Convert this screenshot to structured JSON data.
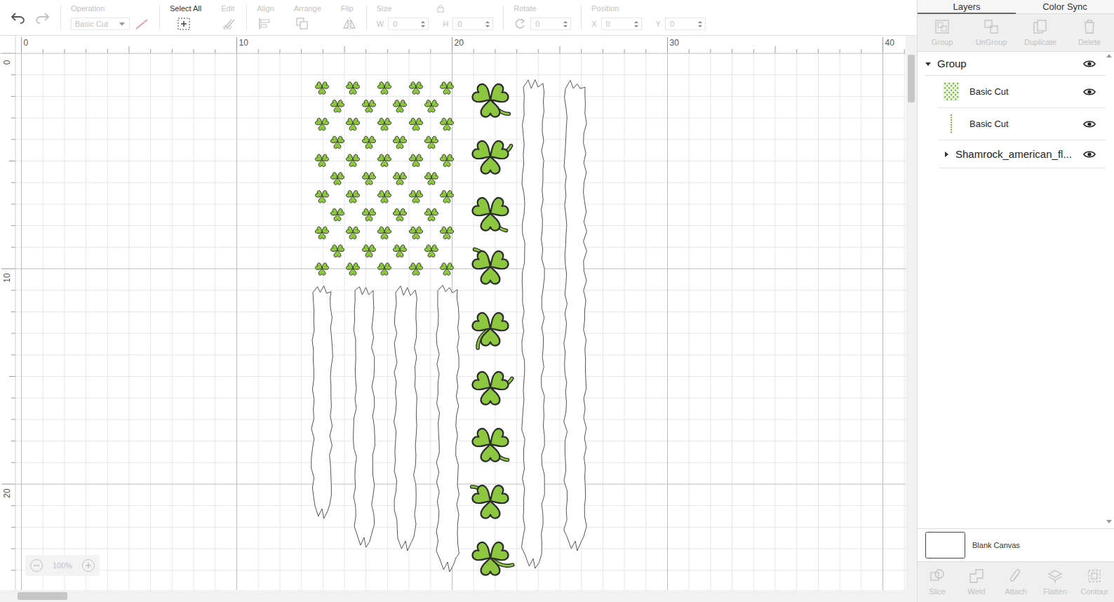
{
  "toolbar": {
    "undo": {
      "disabled": false
    },
    "redo": {
      "disabled": true
    },
    "tools": [
      {
        "kind": "dropdown",
        "label": "Operation",
        "value": "Basic Cut",
        "disabled": true
      },
      {
        "kind": "button",
        "label": "Select All",
        "disabled": false
      },
      {
        "kind": "button",
        "label": "Edit",
        "disabled": true
      },
      {
        "kind": "button",
        "label": "Align",
        "disabled": true
      },
      {
        "kind": "button",
        "label": "Arrange",
        "disabled": true
      },
      {
        "kind": "button",
        "label": "Flip",
        "disabled": true
      },
      {
        "kind": "fields",
        "label": "Size",
        "disabled": true,
        "fields": [
          {
            "label": "W",
            "value": "0"
          },
          {
            "label": "H",
            "value": "0"
          }
        ]
      },
      {
        "kind": "fields",
        "label": "Rotate",
        "disabled": true,
        "fields": [
          {
            "value": "0"
          }
        ]
      },
      {
        "kind": "fields",
        "label": "Position",
        "disabled": true,
        "fields": [
          {
            "label": "X",
            "value": "0"
          },
          {
            "label": "Y",
            "value": "0"
          }
        ]
      }
    ]
  },
  "canvas": {
    "ruler_top": [
      "0",
      "10",
      "20",
      "30",
      "40"
    ],
    "ruler_left": [
      "0",
      "10",
      "20"
    ],
    "zoom": {
      "value": "100%",
      "disabled": true
    }
  },
  "panel": {
    "tabs": [
      {
        "label": "Layers",
        "selected": true
      },
      {
        "label": "Color Sync",
        "selected": false
      }
    ],
    "actions": [
      {
        "label": "Group",
        "disabled": true
      },
      {
        "label": "UnGroup",
        "disabled": true
      },
      {
        "label": "Duplicate",
        "disabled": true
      },
      {
        "label": "Delete",
        "disabled": true
      }
    ],
    "layers": [
      {
        "kind": "group",
        "label": "Group",
        "depth": 0,
        "expanded": true,
        "visible": true
      },
      {
        "kind": "pattern",
        "label": "Basic Cut",
        "depth": 1,
        "visible": true
      },
      {
        "kind": "line",
        "label": "Basic Cut",
        "depth": 1,
        "visible": true
      },
      {
        "kind": "group",
        "label": "Shamrock_american_fl...",
        "depth": 1,
        "expanded": false,
        "visible": true
      }
    ],
    "canvas": {
      "label": "Blank Canvas"
    },
    "bottom_actions": [
      {
        "label": "Slice",
        "disabled": true
      },
      {
        "label": "Weld",
        "disabled": true
      },
      {
        "label": "Attach",
        "disabled": true
      },
      {
        "label": "Flatten",
        "disabled": true
      },
      {
        "label": "Contour",
        "disabled": true
      }
    ]
  }
}
